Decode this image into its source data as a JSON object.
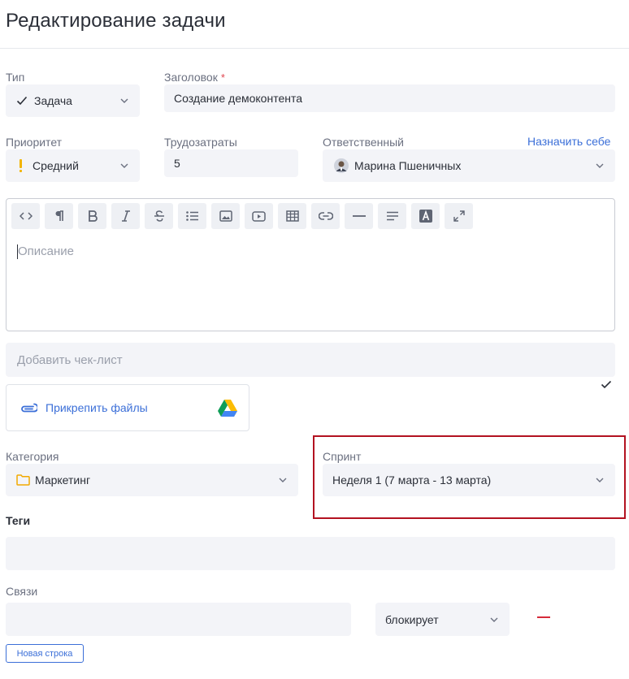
{
  "header": {
    "title": "Редактирование задачи"
  },
  "type": {
    "label": "Тип",
    "value": "Задача"
  },
  "heading": {
    "label": "Заголовок",
    "required_mark": "*",
    "value": "Создание демоконтента"
  },
  "priority": {
    "label": "Приоритет",
    "value": "Средний",
    "icon": "exclamation-icon",
    "icon_color": "#f2b400"
  },
  "effort": {
    "label": "Трудозатраты",
    "value": "5"
  },
  "assignee": {
    "label": "Ответственный",
    "assign_self": "Назначить себе",
    "value": "Марина Пшеничных"
  },
  "editor": {
    "placeholder": "Описание",
    "toolbar": [
      "code-icon",
      "paragraph-icon",
      "bold-icon",
      "italic-icon",
      "strikethrough-icon",
      "list-icon",
      "image-icon",
      "video-icon",
      "table-icon",
      "link-icon",
      "horizontal-rule-icon",
      "align-icon",
      "text-color-icon",
      "fullscreen-icon"
    ]
  },
  "checklist": {
    "placeholder": "Добавить чек-лист"
  },
  "attachments": {
    "label": "Прикрепить файлы",
    "icon": "paperclip-icon",
    "drive_icon": "google-drive-icon"
  },
  "category": {
    "label": "Категория",
    "value": "Маркетинг",
    "icon": "folder-icon"
  },
  "sprint": {
    "label": "Спринт",
    "value": "Неделя 1 (7 марта - 13 марта)",
    "highlight_color": "#b31221"
  },
  "tags": {
    "label": "Теги",
    "value": ""
  },
  "relations": {
    "label": "Связи",
    "type_value": "блокирует",
    "new_row": "Новая строка"
  },
  "colors": {
    "accent": "#3b6fd8",
    "field_bg": "#f3f4f8",
    "danger": "#d62b3a"
  }
}
